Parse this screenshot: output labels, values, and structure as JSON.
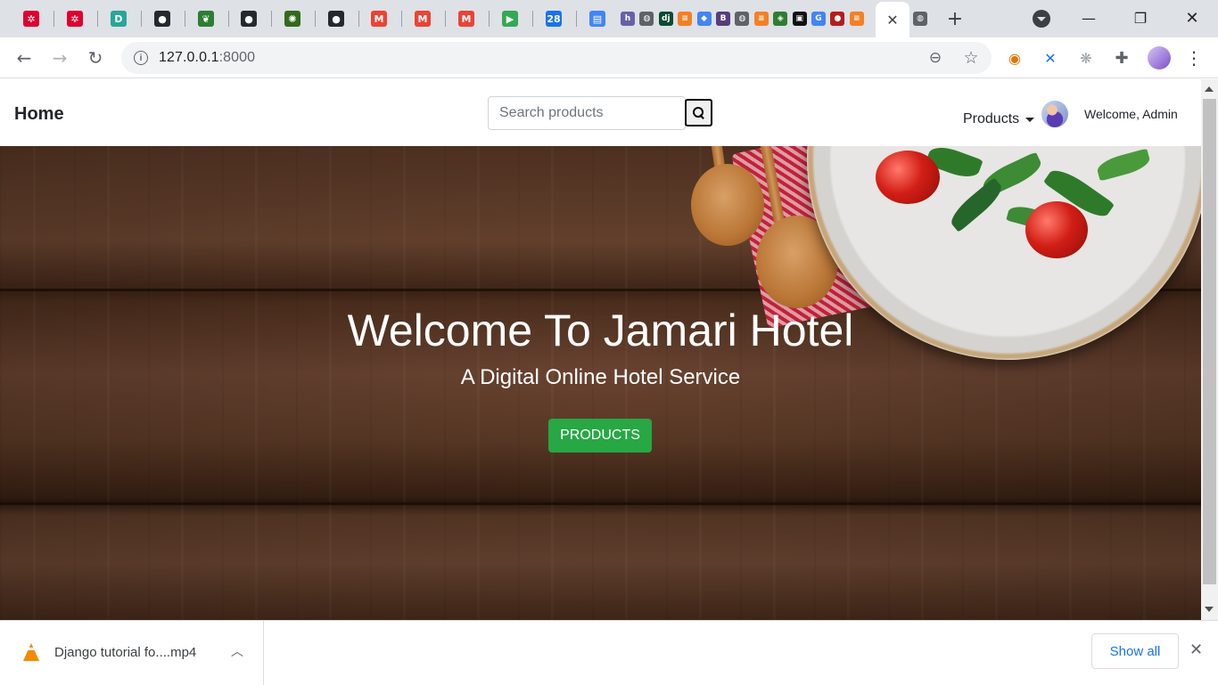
{
  "browser": {
    "pinned_tabs": [
      {
        "icon": "angular-icon",
        "glyph": "✲",
        "bg": "#dd0031"
      },
      {
        "icon": "angular-icon",
        "glyph": "✲",
        "bg": "#dd0031"
      },
      {
        "icon": "devpost-icon",
        "glyph": "D",
        "bg": "#26a69a"
      },
      {
        "icon": "github-icon",
        "glyph": "●",
        "bg": "#24292e"
      },
      {
        "icon": "leaf-app-icon",
        "glyph": "❦",
        "bg": "#2e7d32"
      },
      {
        "icon": "github-icon",
        "glyph": "●",
        "bg": "#24292e"
      },
      {
        "icon": "emblem-icon",
        "glyph": "✺",
        "bg": "#33691e"
      },
      {
        "icon": "github-icon",
        "glyph": "●",
        "bg": "#24292e"
      },
      {
        "icon": "gmail-icon",
        "glyph": "M",
        "bg": "#ea4335"
      },
      {
        "icon": "gmail-icon",
        "glyph": "M",
        "bg": "#ea4335"
      },
      {
        "icon": "gmail-icon",
        "glyph": "M",
        "bg": "#ea4335"
      },
      {
        "icon": "play-icon",
        "glyph": "▶",
        "bg": "#34a853"
      },
      {
        "icon": "calendar-icon",
        "glyph": "28",
        "bg": "#1a73e8"
      },
      {
        "icon": "translate-icon",
        "glyph": "▤",
        "bg": "#4285f4"
      }
    ],
    "small_tabs": [
      {
        "icon": "heroku-icon",
        "glyph": "h",
        "bg": "#6762a6"
      },
      {
        "icon": "globe-icon",
        "glyph": "◍",
        "bg": "#5f6368"
      },
      {
        "icon": "django-icon",
        "glyph": "dj",
        "bg": "#0c4b33"
      },
      {
        "icon": "stackoverflow-icon",
        "glyph": "≡",
        "bg": "#f48024"
      },
      {
        "icon": "location-icon",
        "glyph": "◆",
        "bg": "#4285f4"
      },
      {
        "icon": "bootstrap-icon",
        "glyph": "B",
        "bg": "#563d7c"
      },
      {
        "icon": "globe-icon",
        "glyph": "◍",
        "bg": "#5f6368"
      },
      {
        "icon": "stackoverflow-icon",
        "glyph": "≡",
        "bg": "#f48024"
      },
      {
        "icon": "diamond-icon",
        "glyph": "◈",
        "bg": "#2e7d32"
      },
      {
        "icon": "film-icon",
        "glyph": "▣",
        "bg": "#111111"
      },
      {
        "icon": "google-icon",
        "glyph": "G",
        "bg": "#4285f4"
      },
      {
        "icon": "dots-icon",
        "glyph": "●",
        "bg": "#b71c1c"
      },
      {
        "icon": "stackoverflow-icon",
        "glyph": "≡",
        "bg": "#f48024"
      }
    ],
    "active_tab": {
      "icon": "close-icon",
      "glyph": "✕"
    },
    "after_active": {
      "icon": "globe-icon",
      "glyph": "◍",
      "bg": "#5f6368"
    },
    "new_tab_glyph": "+",
    "window": {
      "minimize": "—",
      "restore": "❐",
      "close": "✕"
    },
    "nav": {
      "back": "←",
      "forward": "→",
      "reload": "↻"
    },
    "address": {
      "host": "127.0.0.1",
      "port": ":8000"
    },
    "omnibox_icons": {
      "zoom": "⊖",
      "star": "☆"
    },
    "extensions": [
      {
        "icon": "extension-orange-icon",
        "glyph": "◉",
        "bg": "#ffffff",
        "fg": "#e37400"
      },
      {
        "icon": "extension-compass-icon",
        "glyph": "✕",
        "bg": "#ffffff",
        "fg": "#1a73e8"
      },
      {
        "icon": "extension-gear-icon",
        "glyph": "❋",
        "bg": "#ffffff",
        "fg": "#9aa0a6"
      },
      {
        "icon": "puzzle-icon",
        "glyph": "✚",
        "bg": "#ffffff",
        "fg": "#5f6368"
      }
    ],
    "menu_glyph": "⋮"
  },
  "site": {
    "brand": "Home",
    "search": {
      "placeholder": "Search products"
    },
    "products_menu": "Products",
    "welcome": "Welcome, Admin"
  },
  "hero": {
    "title": "Welcome To Jamari Hotel",
    "subtitle": "A Digital Online Hotel Service",
    "button": "PRODUCTS"
  },
  "downloads": {
    "file_name": "Django tutorial fo....mp4",
    "chevron": "︿",
    "show_all": "Show all",
    "close": "✕"
  },
  "colors": {
    "success": "#28a745",
    "link_blue": "#1a73e8"
  }
}
